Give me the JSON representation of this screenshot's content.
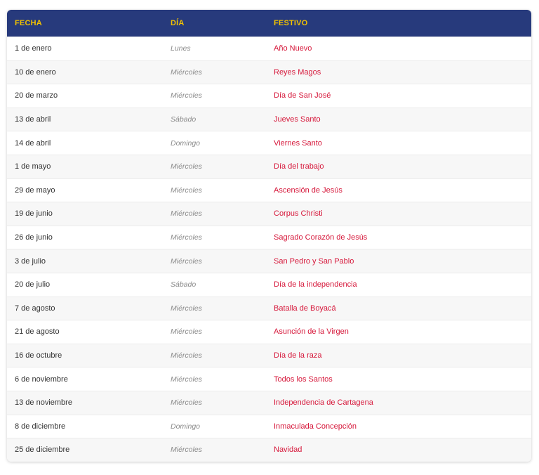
{
  "table": {
    "headers": {
      "fecha": "FECHA",
      "dia": "DÍA",
      "festivo": "FESTIVO"
    },
    "colors": {
      "header_bg": "#273a7c",
      "header_text": "#f2c200",
      "festivo_text": "#d6173a"
    },
    "rows": [
      {
        "fecha": "1 de enero",
        "dia": "Lunes",
        "festivo": "Año Nuevo"
      },
      {
        "fecha": "10 de enero",
        "dia": "Miércoles",
        "festivo": "Reyes Magos"
      },
      {
        "fecha": "20 de marzo",
        "dia": "Miércoles",
        "festivo": "Día de San José"
      },
      {
        "fecha": "13 de abril",
        "dia": "Sábado",
        "festivo": "Jueves Santo"
      },
      {
        "fecha": "14 de abril",
        "dia": "Domingo",
        "festivo": "Viernes Santo"
      },
      {
        "fecha": "1 de mayo",
        "dia": "Miércoles",
        "festivo": "Día del trabajo"
      },
      {
        "fecha": "29 de mayo",
        "dia": "Miércoles",
        "festivo": "Ascensión de Jesús"
      },
      {
        "fecha": "19 de junio",
        "dia": "Miércoles",
        "festivo": "Corpus Christi"
      },
      {
        "fecha": "26 de junio",
        "dia": "Miércoles",
        "festivo": "Sagrado Corazón de Jesús"
      },
      {
        "fecha": "3 de julio",
        "dia": "Miércoles",
        "festivo": "San Pedro y San Pablo"
      },
      {
        "fecha": "20 de julio",
        "dia": "Sábado",
        "festivo": "Día de la independencia"
      },
      {
        "fecha": "7 de agosto",
        "dia": "Miércoles",
        "festivo": "Batalla de Boyacá"
      },
      {
        "fecha": "21 de agosto",
        "dia": "Miércoles",
        "festivo": "Asunción de la Virgen"
      },
      {
        "fecha": "16 de octubre",
        "dia": "Miércoles",
        "festivo": "Día de la raza"
      },
      {
        "fecha": "6 de noviembre",
        "dia": "Miércoles",
        "festivo": "Todos los Santos"
      },
      {
        "fecha": "13 de noviembre",
        "dia": "Miércoles",
        "festivo": "Independencia de Cartagena"
      },
      {
        "fecha": "8 de diciembre",
        "dia": "Domingo",
        "festivo": "Inmaculada Concepción"
      },
      {
        "fecha": "25 de diciembre",
        "dia": "Miércoles",
        "festivo": "Navidad"
      }
    ]
  }
}
